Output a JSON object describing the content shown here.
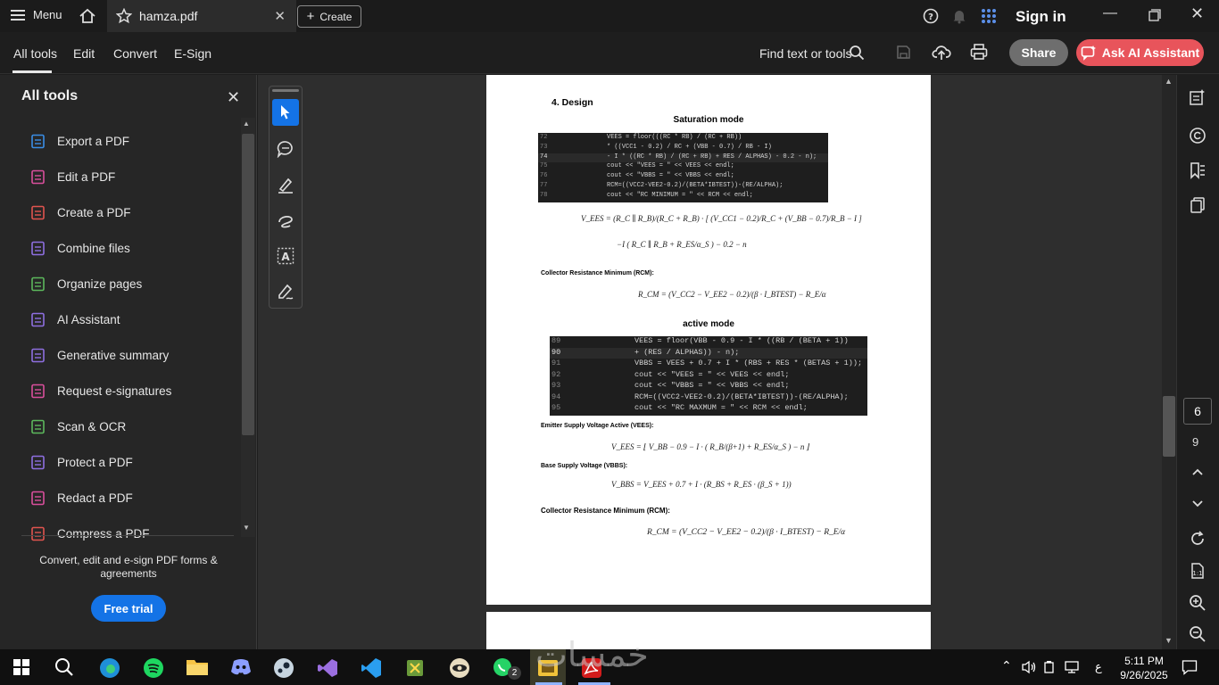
{
  "titlebar": {
    "menu_label": "Menu",
    "tab_title": "hamza.pdf",
    "create_label": "Create",
    "sign_in_label": "Sign in"
  },
  "toolbar": {
    "tabs": [
      "All tools",
      "Edit",
      "Convert",
      "E-Sign"
    ],
    "find_label": "Find text or tools",
    "share_label": "Share",
    "ai_label": "Ask AI Assistant"
  },
  "panel": {
    "title": "All tools",
    "items": [
      {
        "label": "Export a PDF",
        "color": "#3a8ee6"
      },
      {
        "label": "Edit a PDF",
        "color": "#d94f9c"
      },
      {
        "label": "Create a PDF",
        "color": "#e0544f"
      },
      {
        "label": "Combine files",
        "color": "#8e6fe0"
      },
      {
        "label": "Organize pages",
        "color": "#5cb85c"
      },
      {
        "label": "AI Assistant",
        "color": "#8e6fe0"
      },
      {
        "label": "Generative summary",
        "color": "#8e6fe0"
      },
      {
        "label": "Request e-signatures",
        "color": "#d94f9c"
      },
      {
        "label": "Scan & OCR",
        "color": "#5cb85c"
      },
      {
        "label": "Protect a PDF",
        "color": "#8e6fe0"
      },
      {
        "label": "Redact a PDF",
        "color": "#d94f9c"
      },
      {
        "label": "Compress a PDF",
        "color": "#e0544f"
      }
    ],
    "promo_text": "Convert, edit and e-sign PDF forms & agreements",
    "trial_label": "Free trial"
  },
  "document": {
    "heading": "4.  Design",
    "saturation_title": "Saturation mode",
    "active_title": "active mode",
    "code1": [
      {
        "n": "72",
        "t": "VEES = floor(((RC * RB) / (RC + RB))"
      },
      {
        "n": "73",
        "t": "* ((VCC1 - 0.2) / RC + (VBB - 0.7) / RB - I)"
      },
      {
        "n": "74",
        "t": "- I * ((RC * RB) / (RC + RB) + RES / ALPHAS) - 0.2 - n);"
      },
      {
        "n": "75",
        "t": "cout << \"VEES = \" << VEES << endl;"
      },
      {
        "n": "76",
        "t": "cout << \"VBBS = \" << VBBS << endl;"
      },
      {
        "n": "77",
        "t": "RCM=((VCC2-VEE2-0.2)/(BETA*IBTEST))-(RE/ALPHA);"
      },
      {
        "n": "78",
        "t": "cout << \"RC MINIMUM = \" << RCM << endl;"
      }
    ],
    "code2": [
      {
        "n": "89",
        "t": "VEES = floor(VBB - 0.9 - I * ((RB / (BETA + 1))"
      },
      {
        "n": "90",
        "t": "+ (RES / ALPHAS)) - n);"
      },
      {
        "n": "91",
        "t": "VBBS = VEES + 0.7 + I * (RBS + RES * (BETAS + 1));"
      },
      {
        "n": "92",
        "t": "cout << \"VEES = \" << VEES << endl;"
      },
      {
        "n": "93",
        "t": "cout << \"VBBS = \" << VBBS << endl;"
      },
      {
        "n": "94",
        "t": "RCM=((VCC2-VEE2-0.2)/(BETA*IBTEST))-(RE/ALPHA);"
      },
      {
        "n": "95",
        "t": "cout << \"RC MAXMUM = \" << RCM << endl;"
      }
    ],
    "eq1_line1": "V_EES = (R_C ∥ R_B)/(R_C + R_B) · [ (V_CC1 − 0.2)/R_C + (V_BB − 0.7)/R_B − I ]",
    "eq1_line2": "−I ( R_C ∥ R_B + R_ES/α_S ) − 0.2 − n",
    "rcm_label_1": "Collector Resistance Minimum (RCM):",
    "eq_rcm_1": "R_CM = (V_CC2 − V_EE2 − 0.2)/(β · I_BTEST) − R_E/α",
    "vees_label": "Emitter Supply Voltage Active (VEES):",
    "eq_vees": "V_EES = ⌊ V_BB − 0.9 − I · ( R_B/(β+1) + R_ES/α_S ) − n ⌋",
    "vbbs_label": "Base Supply Voltage (VBBS):",
    "eq_vbbs": "V_BBS = V_EES + 0.7 + I · (R_BS + R_ES · (β_S + 1))",
    "rcm_label_2": "Collector Resistance Minimum (RCM):",
    "eq_rcm_2": "R_CM = (V_CC2 − V_EE2 − 0.2)/(β · I_BTEST) − R_E/α"
  },
  "navigation": {
    "current_page": "6",
    "total_pages": "9"
  },
  "taskbar": {
    "time": "5:11 PM",
    "date": "9/26/2025",
    "lang": "ع",
    "whatsapp_badge": "2"
  },
  "watermark": "خمسات"
}
